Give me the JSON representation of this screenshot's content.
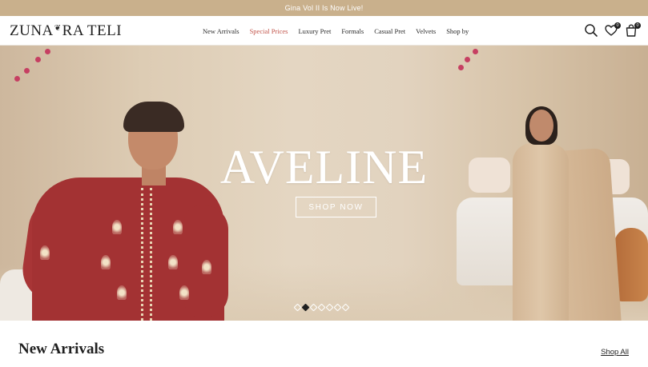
{
  "announcement": {
    "text": "Gina Vol II Is Now Live!"
  },
  "header": {
    "logo_part1": "ZUNA",
    "logo_glyph": "❦",
    "logo_part2": "RA TELI",
    "nav": [
      {
        "label": "New Arrivals",
        "active": false
      },
      {
        "label": "Special Prices",
        "active": true
      },
      {
        "label": "Luxury Pret",
        "active": false
      },
      {
        "label": "Formals",
        "active": false
      },
      {
        "label": "Casual Pret",
        "active": false
      },
      {
        "label": "Velvets",
        "active": false
      },
      {
        "label": "Shop by",
        "active": false
      }
    ],
    "icons": {
      "search": "search-icon",
      "wishlist": "heart-icon",
      "wishlist_count": "0",
      "cart": "shopping-bag-icon",
      "cart_count": "0"
    }
  },
  "hero": {
    "title": "AVELINE",
    "cta_label": "SHOP NOW",
    "slide_count": 7,
    "active_slide": 2
  },
  "section": {
    "title": "New Arrivals",
    "link_label": "Shop All"
  },
  "colors": {
    "announcement_bg": "#c9b08c",
    "accent_nav": "#c2544a",
    "text_dark": "#1f1f1f"
  }
}
